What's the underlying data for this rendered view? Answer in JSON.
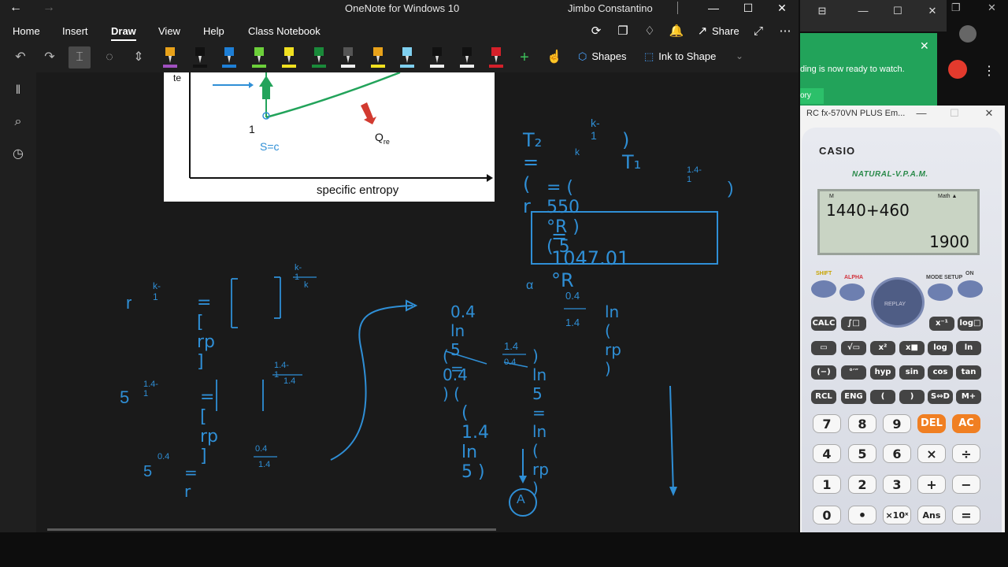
{
  "onenote": {
    "title": "OneNote for Windows 10",
    "user": "Jimbo Constantino",
    "tabs": [
      "Home",
      "Insert",
      "Draw",
      "View",
      "Help",
      "Class Notebook"
    ],
    "active_tab": "Draw",
    "share_label": "Share",
    "shapes_label": "Shapes",
    "ink_to_shape_label": "Ink to Shape",
    "pen_colors": [
      "#e8a21a",
      "#111111",
      "#1e7fd6",
      "#6ccf3a",
      "#f0e020",
      "#1a8a3a",
      "#555555",
      "#e8a21a",
      "#7fd0f0",
      "#111111",
      "#111111",
      "#d4202a"
    ],
    "pen_bar_colors": [
      "#a050c0",
      "#111111",
      "#1e7fd6",
      "#6ccf3a",
      "#f0e020",
      "#1a8a3a",
      "#eeeeee",
      "#f0e020",
      "#7fd0f0",
      "#eeeeee",
      "#eeeeee",
      "#d4202a"
    ],
    "ink_color": "#2f8fd6"
  },
  "diagram": {
    "xlabel": "specific entropy",
    "ylabel_partial": "te",
    "point_label": "1",
    "process_label": "S=c",
    "heat_label": "Q",
    "heat_sub": "re"
  },
  "notes": {
    "t2_eq": "T₂ = ( r",
    "t2_sub": "k",
    "t2_exp": "k-1",
    "t2_tail": ") T₁",
    "sub_line": "= ( 550 °R ) ( 5",
    "sub_exp": "1.4-1",
    "sub_tail": ")",
    "result": "= 1047.01 °R",
    "ratio_lhs": "r",
    "ratio_exp": "k-1",
    "ratio_mid": "= [ rp ]",
    "ratio_exp2_top": "k-1",
    "ratio_exp2_bot": "k",
    "line2": "5",
    "line2_exp": "1.4-1",
    "line2_mid": "= [ rp ]",
    "line2_top": "1.4-1",
    "line2_bot": "1.4",
    "line3": "5",
    "line3_exp": "0.4",
    "line3_mid": "=   r",
    "line3_top": "0.4",
    "line3_bot": "1.4",
    "ln1_lhs": "0.4 ln 5  =",
    "ln1_frac_top": "0.4",
    "ln1_frac_bot": "1.4",
    "ln1_rhs": "ln ( rp )",
    "ln1_mark": "α",
    "ln2_lhs": "( 0.4 ) (",
    "ln2_frac_top": "1.4",
    "ln2_frac_bot": "0.4",
    "ln2_rhs": ") ln 5  =  ln ( rp )",
    "ln3": "( 1.4 ln 5 )",
    "circle_label": "A"
  },
  "zoom": {
    "notification": "ding is now ready to watch.",
    "link_partial": "ory"
  },
  "calculator": {
    "window_title": "RC fx-570VN PLUS Em...",
    "brand": "CASIO",
    "model_label": "NATURAL-V.P.A.M.",
    "display_expression": "1440+460",
    "display_result": "1900",
    "ind_m": "M",
    "ind_math": "Math ▲",
    "shift": "SHIFT",
    "alpha": "ALPHA",
    "mode": "MODE SETUP",
    "on": "ON",
    "replay": "REPLAY",
    "row1": [
      "CALC",
      "∫□",
      "x⁻¹",
      "log□"
    ],
    "row2": [
      "▭",
      "√▭",
      "x²",
      "x■",
      "log",
      "ln"
    ],
    "row3": [
      "(−)",
      "°′″",
      "hyp",
      "sin",
      "cos",
      "tan"
    ],
    "row4": [
      "RCL",
      "ENG",
      "(",
      ")",
      "S⇔D",
      "M+"
    ],
    "row5": [
      "7",
      "8",
      "9",
      "DEL",
      "AC"
    ],
    "row6": [
      "4",
      "5",
      "6",
      "×",
      "÷"
    ],
    "row7": [
      "1",
      "2",
      "3",
      "+",
      "−"
    ],
    "row8": [
      "0",
      "•",
      "×10ˣ",
      "Ans",
      "="
    ]
  }
}
